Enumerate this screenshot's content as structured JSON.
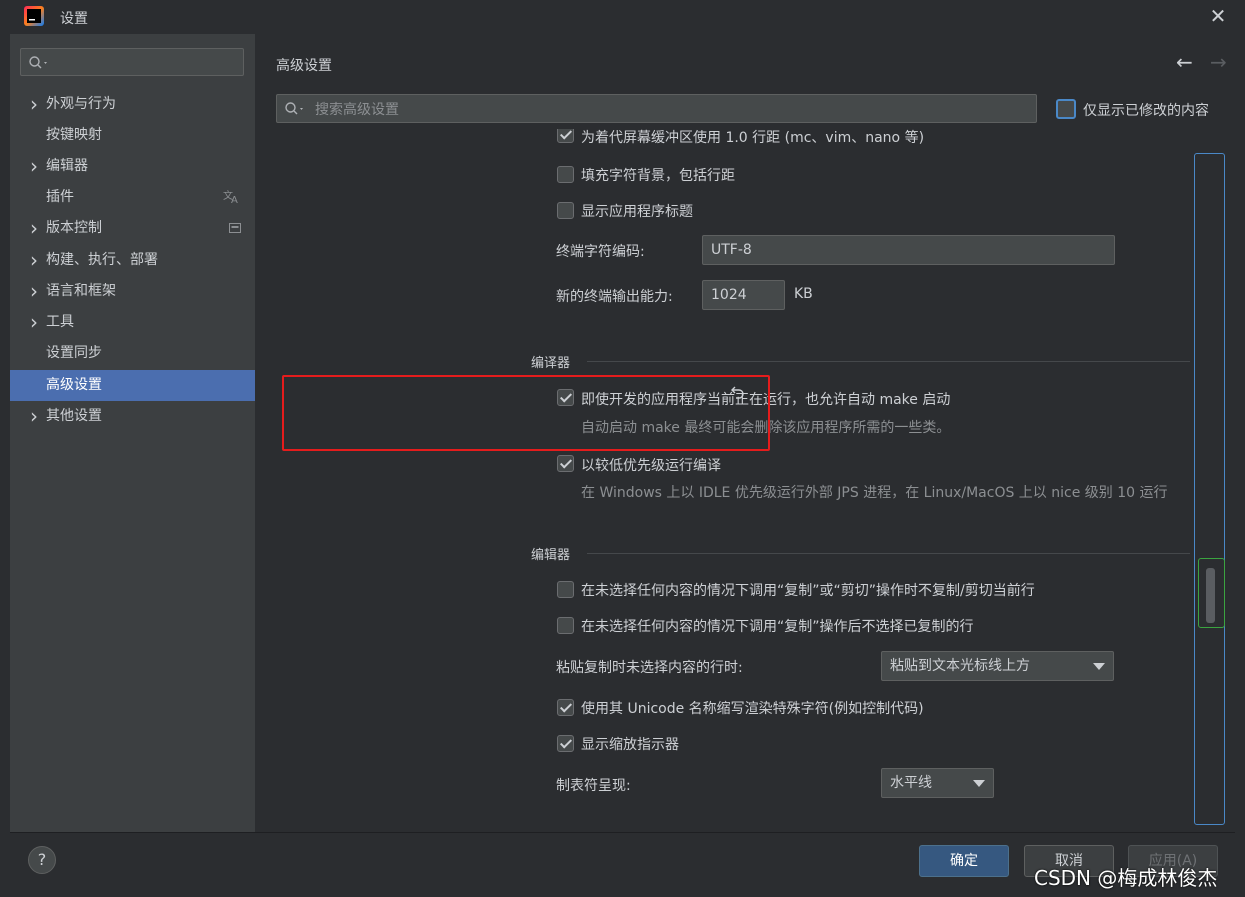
{
  "window": {
    "title": "设置",
    "close_glyph": "✕"
  },
  "sidebar": {
    "items": [
      {
        "label": "外观与行为",
        "expandable": true
      },
      {
        "label": "按键映射",
        "expandable": false
      },
      {
        "label": "编辑器",
        "expandable": true
      },
      {
        "label": "插件",
        "expandable": false,
        "right_icon": "translate-icon"
      },
      {
        "label": "版本控制",
        "expandable": true,
        "right_icon": "project-scope-icon"
      },
      {
        "label": "构建、执行、部署",
        "expandable": true
      },
      {
        "label": "语言和框架",
        "expandable": true
      },
      {
        "label": "工具",
        "expandable": true
      },
      {
        "label": "设置同步",
        "expandable": false
      },
      {
        "label": "高级设置",
        "expandable": false,
        "selected": true
      },
      {
        "label": "其他设置",
        "expandable": true
      }
    ]
  },
  "header": {
    "title": "高级设置",
    "back_glyph": "←",
    "forward_glyph": "→",
    "search_placeholder": "搜索高级设置",
    "modified_only_label": "仅显示已修改的内容"
  },
  "terminal": {
    "cut_off_option": "为着代屏幕缓冲区使用 1.0 行距 (mc、vim、nano 等)",
    "fill_bg_label": "填充字符背景，包括行距",
    "show_app_title_label": "显示应用程序标题",
    "encoding_label": "终端字符编码:",
    "encoding_value": "UTF-8",
    "output_capacity_label": "新的终端输出能力:",
    "output_capacity_value": "1024",
    "output_capacity_unit": "KB"
  },
  "compiler": {
    "section_title": "编译器",
    "auto_make_label": "即使开发的应用程序当前正在运行，也允许自动 make 启动",
    "auto_make_desc": "自动启动 make 最终可能会删除该应用程序所需的一些类。",
    "auto_make_checked": true,
    "low_priority_label": "以较低优先级运行编译",
    "low_priority_desc": "在 Windows 上以 IDLE 优先级运行外部 JPS 进程，在 Linux/MacOS 上以 nice 级别 10 运行",
    "low_priority_checked": true
  },
  "editor": {
    "section_title": "编辑器",
    "opt1_label": "在未选择任何内容的情况下调用“复制”或“剪切”操作时不复制/剪切当前行",
    "opt2_label": "在未选择任何内容的情况下调用“复制”操作后不选择已复制的行",
    "paste_label": "粘贴复制时未选择内容的行时:",
    "paste_value": "粘贴到文本光标线上方",
    "unicode_label": "使用其 Unicode 名称缩写渲染特殊字符(例如控制代码)",
    "unicode_checked": true,
    "zoom_indicator_label": "显示缩放指示器",
    "zoom_indicator_checked": true,
    "tab_label": "制表符呈现:",
    "tab_value": "水平线"
  },
  "footer": {
    "help": "?",
    "ok": "确定",
    "cancel": "取消",
    "apply": "应用(A)"
  },
  "watermark": "CSDN @梅成林俊杰",
  "colors": {
    "accent": "#4b6eaf",
    "highlight_box": "#e51c1c",
    "background": "#2b2d30",
    "sidebar": "#3c3f41"
  }
}
